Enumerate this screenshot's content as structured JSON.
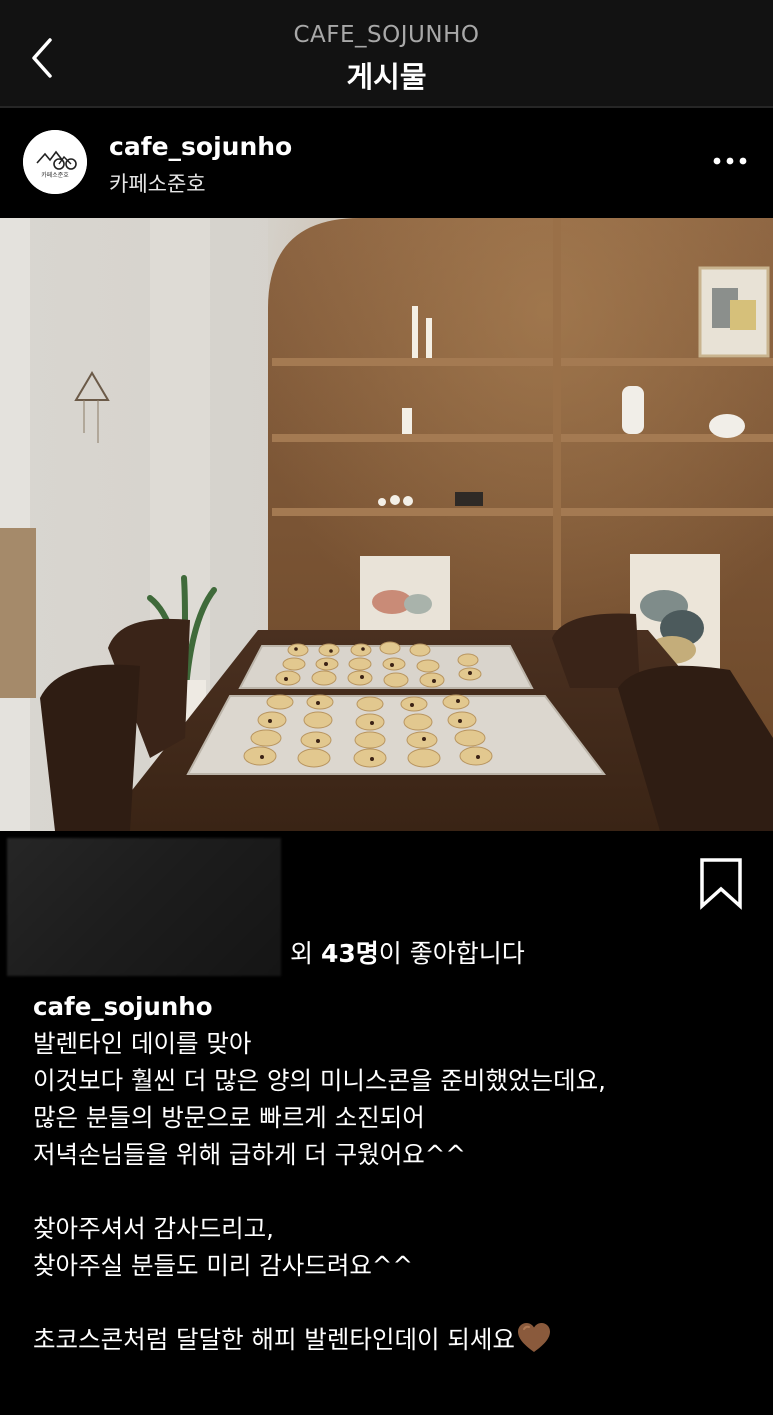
{
  "header": {
    "account_handle": "CAFE_SOJUNHO",
    "title": "게시물",
    "back_icon": "chevron-left-icon"
  },
  "post": {
    "username": "cafe_sojunho",
    "display_name": "카페소준호",
    "avatar_text": "카페소준호",
    "more_icon": "more-horizontal-icon",
    "photo_alt": "Mini chocolate scones on cooling racks on a wooden table in front of wooden shelves"
  },
  "actions": {
    "bookmark_icon": "bookmark-icon",
    "likes_prefix": "외 ",
    "likes_count": "43명",
    "likes_suffix": "이 좋아합니다"
  },
  "caption": {
    "username": "cafe_sojunho",
    "line1": "발렌타인 데이를 맞아",
    "line2": "이것보다 훨씬 더 많은 양의 미니스콘을 준비했었는데요,",
    "line3": "많은 분들의 방문으로 빠르게 소진되어",
    "line4": "저녁손님들을 위해 급하게 더 구웠어요^^",
    "line5": "찾아주셔서 감사드리고,",
    "line6": "찾아주실 분들도 미리 감사드려요^^",
    "line7": "초코스콘처럼 달달한 해피 발렌타인데이 되세요",
    "heart_icon": "brown-heart-icon"
  },
  "colors": {
    "background": "#000000",
    "header_bg": "#121212",
    "secondary_text": "#a8a8a8",
    "heart": "#8a5a3c"
  }
}
